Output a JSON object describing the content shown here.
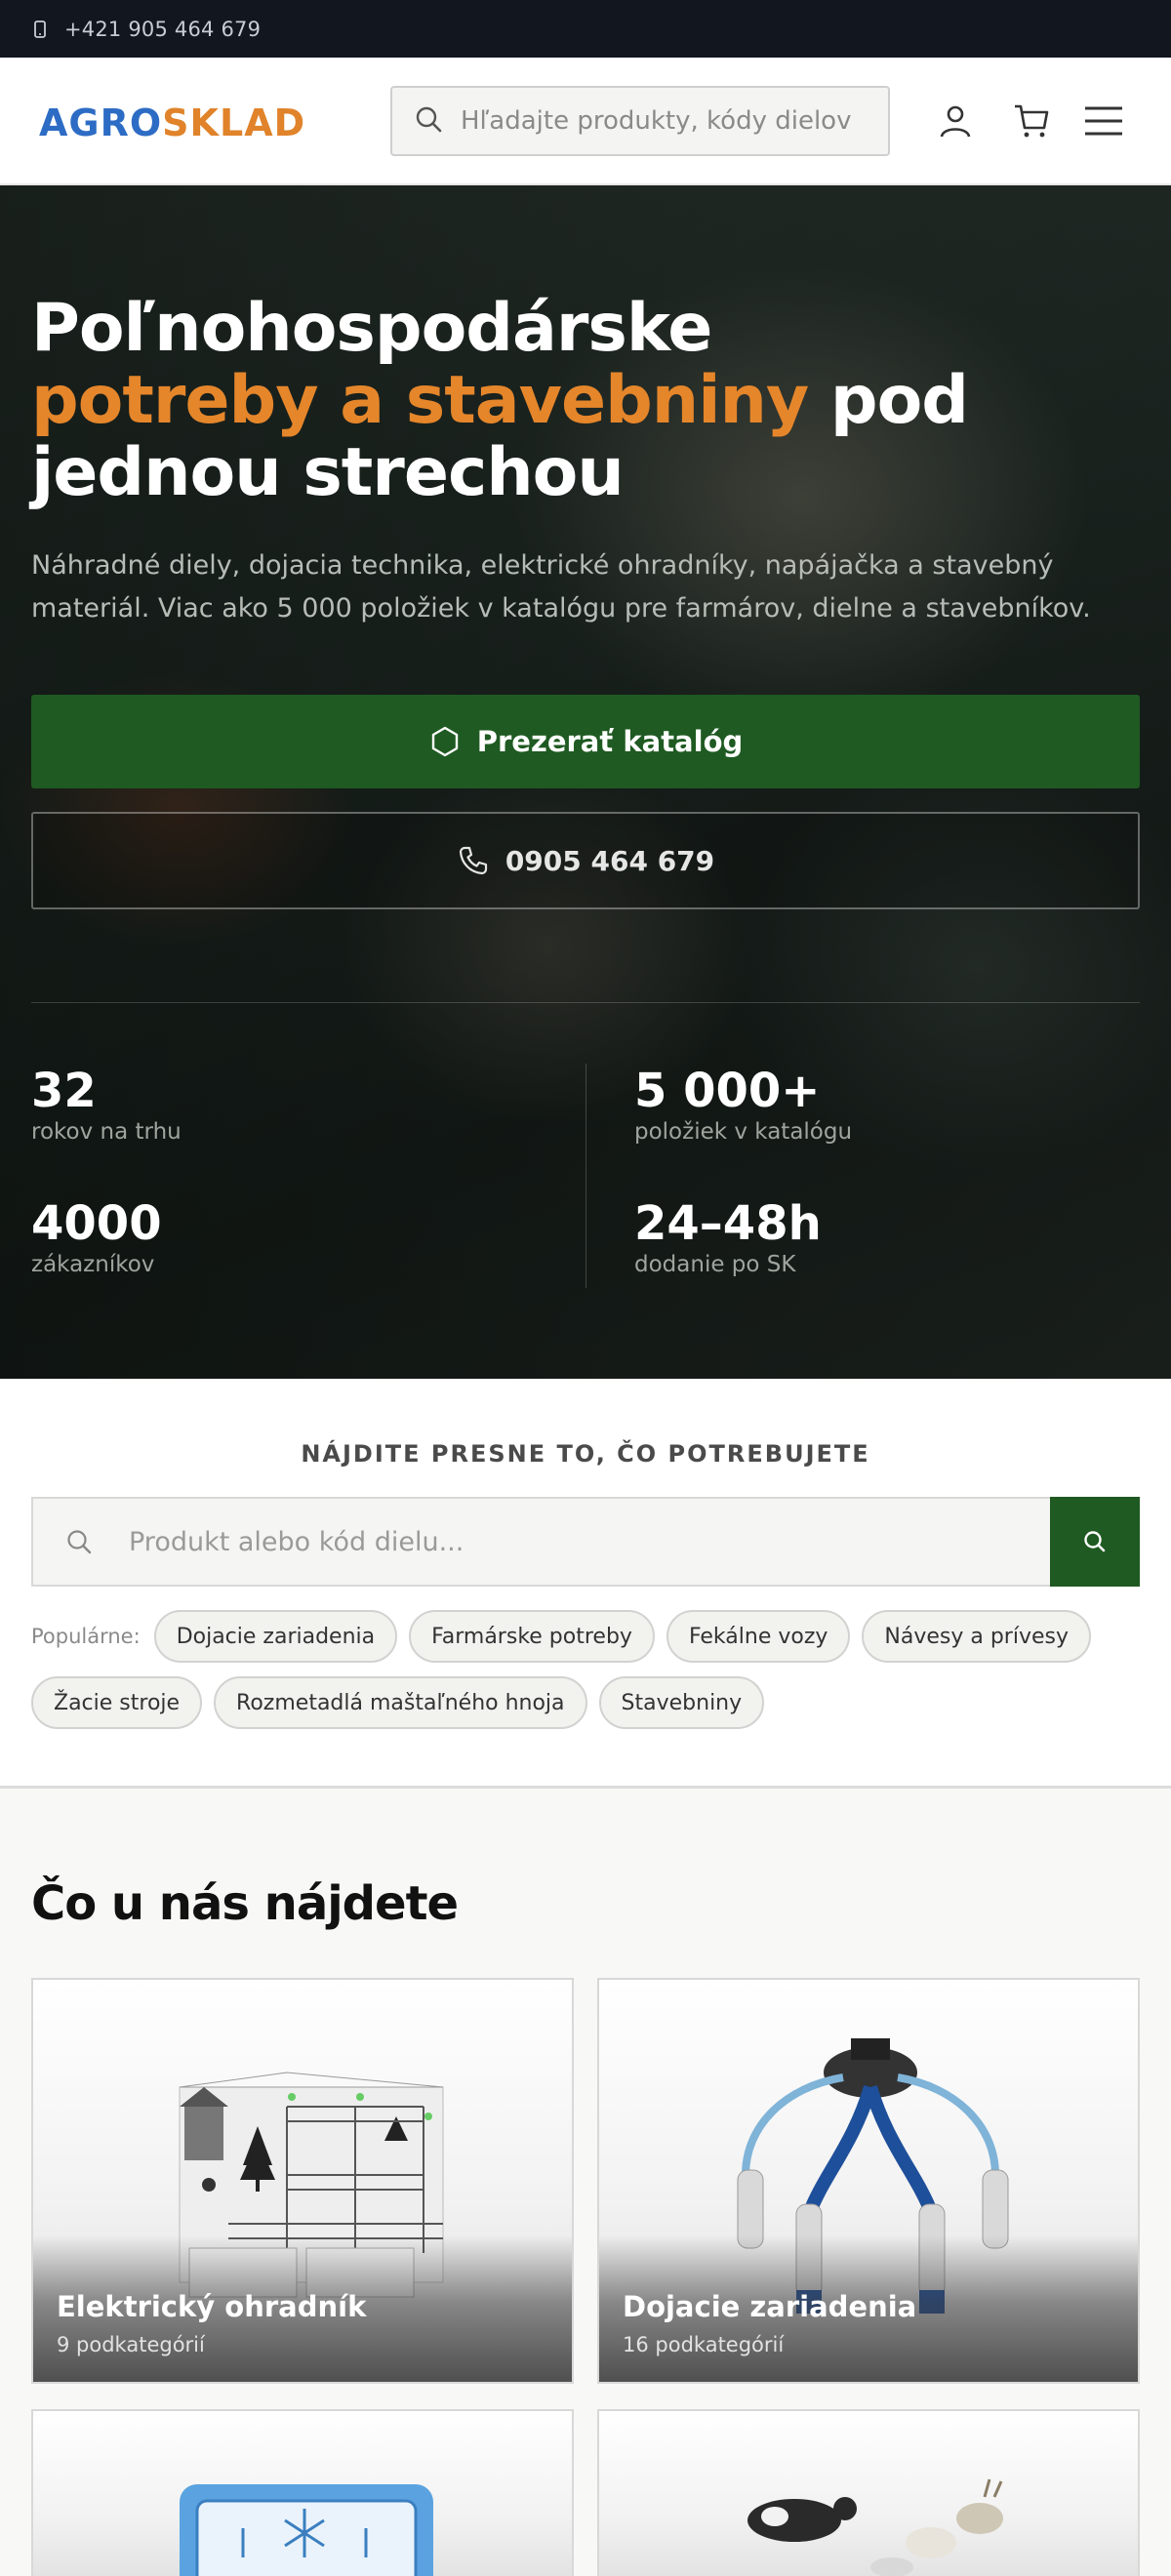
{
  "topbar": {
    "phone": "+421 905 464 679"
  },
  "header": {
    "logo_part1": "AGRO",
    "logo_part2": "SKLAD",
    "search_placeholder": "Hľadajte produkty, kódy dielov..."
  },
  "hero": {
    "title_line1": "Poľnohospodárske",
    "title_accent": "potreby a stavebniny",
    "title_rest": " pod jednou strechou",
    "lead": "Náhradné diely, dojacia technika, elektrické ohradníky, napájačka a stavebný materiál. Viac ako 5 000 položiek v katalógu pre farmárov, dielne a stavebníkov.",
    "cta_primary": "Prezerať katalóg",
    "cta_phone": "0905 464 679",
    "stats": [
      {
        "value": "32",
        "label": "rokov na trhu"
      },
      {
        "value": "5 000+",
        "label": "položiek v katalógu"
      },
      {
        "value": "4000",
        "label": "zákazníkov"
      },
      {
        "value": "24–48h",
        "label": "dodanie po SK"
      }
    ]
  },
  "finder": {
    "title": "NÁJDITE PRESNE TO, ČO POTREBUJETE",
    "search_placeholder": "Produkt alebo kód dielu...",
    "popular_label": "Populárne:",
    "chips": [
      "Dojacie zariadenia",
      "Farmárske potreby",
      "Fekálne vozy",
      "Návesy a prívesy",
      "Žacie stroje",
      "Rozmetadlá maštaľného hnoja",
      "Stavebniny"
    ]
  },
  "categories": {
    "title": "Čo u nás nájdete",
    "items": [
      {
        "name": "Elektrický ohradník",
        "sub": "9 podkategórií"
      },
      {
        "name": "Dojacie zariadenia",
        "sub": "16 podkategórií"
      },
      {
        "name": "",
        "sub": ""
      },
      {
        "name": "",
        "sub": ""
      }
    ]
  },
  "colors": {
    "brand_green": "#1f5a22",
    "accent_orange": "#e5862b",
    "logo_blue": "#2d6cc4",
    "topbar_bg": "#11161f"
  }
}
